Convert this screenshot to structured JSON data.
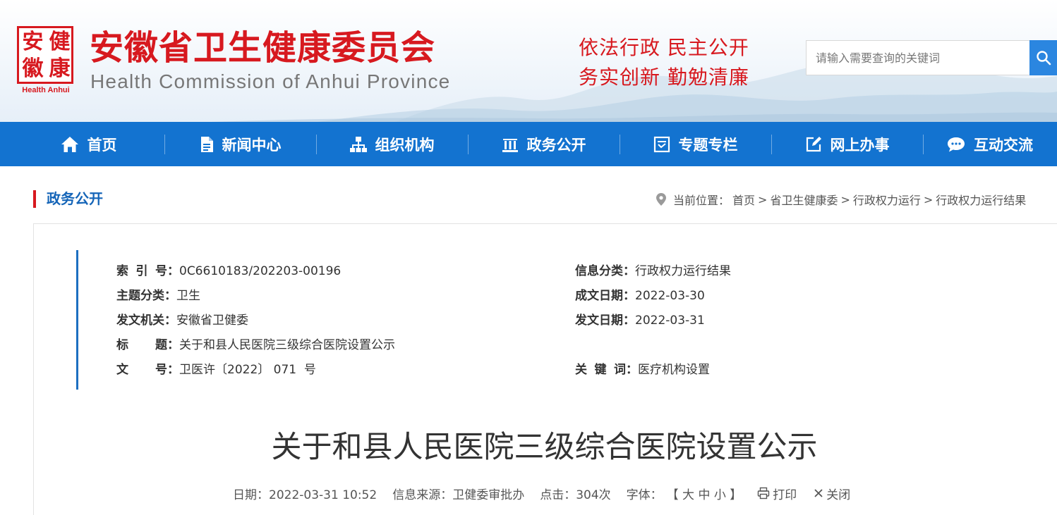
{
  "header": {
    "seal_chars": [
      "安",
      "健",
      "徽",
      "康"
    ],
    "logo_en": "Health Anhui",
    "title_cn": "安徽省卫生健康委员会",
    "title_en": "Health Commission of Anhui Province",
    "slogan_line1": "依法行政  民主公开",
    "slogan_line2": "务实创新  勤勉清廉",
    "search_placeholder": "请输入需要查询的关键词"
  },
  "nav": [
    {
      "label": "首页",
      "icon": "home-icon"
    },
    {
      "label": "新闻中心",
      "icon": "document-icon"
    },
    {
      "label": "组织机构",
      "icon": "org-chart-icon"
    },
    {
      "label": "政务公开",
      "icon": "building-icon"
    },
    {
      "label": "专题专栏",
      "icon": "topic-icon"
    },
    {
      "label": "网上办事",
      "icon": "edit-icon"
    },
    {
      "label": "互动交流",
      "icon": "chat-icon"
    }
  ],
  "section": {
    "title": "政务公开",
    "breadcrumb_prefix": "当前位置：",
    "breadcrumb": [
      "首页",
      "省卫生健康委",
      "行政权力运行",
      "行政权力运行结果"
    ],
    "separator": ">"
  },
  "meta": {
    "index_no_key_chars": [
      "索",
      "引",
      "号"
    ],
    "index_no": "0C6610183/202203-00196",
    "category_key": "信息分类：",
    "category": "行政权力运行结果",
    "topic_key": "主题分类：",
    "topic": "卫生",
    "created_key": "成文日期：",
    "created": "2022-03-30",
    "issuer_key": "发文机关：",
    "issuer": "安徽省卫健委",
    "published_key": "发文日期：",
    "published": "2022-03-31",
    "title_key_chars": [
      "标",
      "题"
    ],
    "title": "关于和县人民医院三级综合医院设置公示",
    "docno_key_chars": [
      "文",
      "号"
    ],
    "docno": "卫医许〔2022〕 071  号",
    "keywords_key_chars": [
      "关",
      "键",
      "词"
    ],
    "keywords": "医疗机构设置",
    "colon": "："
  },
  "article": {
    "title": "关于和县人民医院三级综合医院设置公示",
    "date": "日期：2022-03-31 10:52",
    "source": "信息来源：卫健委审批办",
    "clicks": "点击：304次",
    "font_label": "字体：",
    "font_sizes": "【 大 中 小 】",
    "print": "打印",
    "close": "关闭"
  },
  "colors": {
    "brand_red": "#d7191f",
    "nav_blue": "#1373d0",
    "title_blue": "#1565b8",
    "search_blue": "#2b86e0"
  }
}
